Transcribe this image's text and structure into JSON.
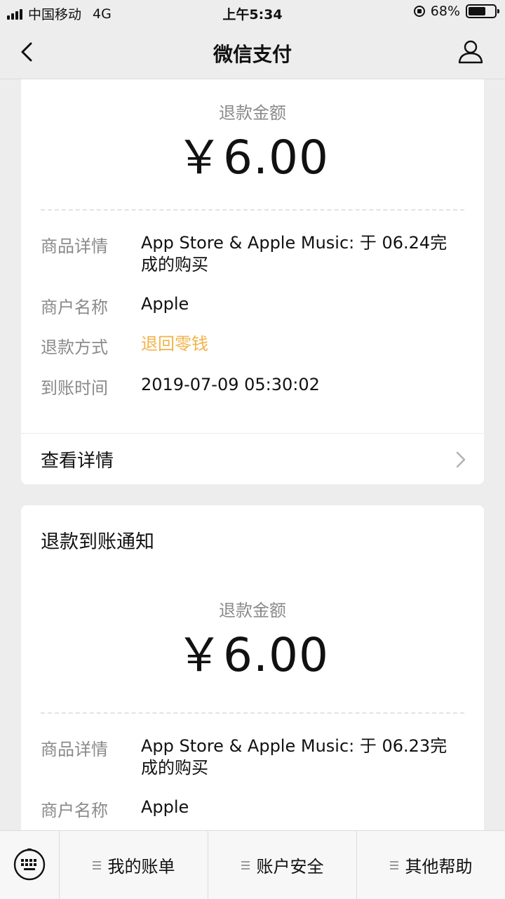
{
  "status_bar": {
    "carrier": "中国移动",
    "network": "4G",
    "time": "上午5:34",
    "battery": "68%",
    "battery_level": 0.68
  },
  "nav": {
    "title": "微信支付",
    "back_icon": "chevron-left-icon",
    "right_icon": "user-icon"
  },
  "cards": [
    {
      "amount_label": "退款金额",
      "amount": "￥6.00",
      "rows": [
        {
          "label": "商品详情",
          "value": "App Store & Apple Music: 于 06.24完成的购买"
        },
        {
          "label": "商户名称",
          "value": "Apple"
        },
        {
          "label": "退款方式",
          "value": "退回零钱"
        },
        {
          "label": "到账时间",
          "value": "2019-07-09 05:30:02"
        }
      ],
      "detail_link": "查看详情"
    },
    {
      "title": "退款到账通知",
      "amount_label": "退款金额",
      "amount": "￥6.00",
      "rows": [
        {
          "label": "商品详情",
          "value": "App Store & Apple Music: 于 06.23完成的购买"
        },
        {
          "label": "商户名称",
          "value": "Apple"
        }
      ]
    }
  ],
  "bottom_menu": [
    {
      "label": "我的账单"
    },
    {
      "label": "账户安全"
    },
    {
      "label": "其他帮助"
    }
  ],
  "colors": {
    "accent": "#f2b348",
    "background": "#ededed",
    "muted_text": "#8a8a8a"
  }
}
